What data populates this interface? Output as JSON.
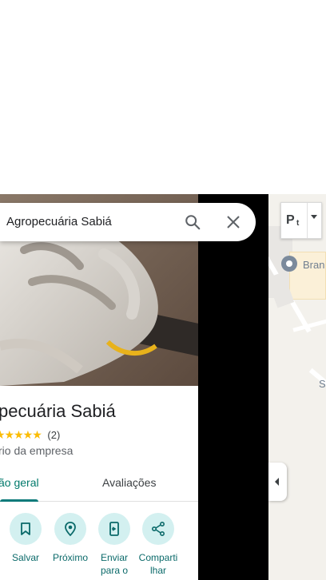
{
  "search": {
    "query": "Agropecuária Sabiá"
  },
  "place": {
    "title": "Agropecuária Sabiá",
    "title_visible": "pecuária Sabiá",
    "rating_stars": "★★★★★",
    "review_count": "(2)",
    "category": "rio da empresa"
  },
  "tabs": [
    {
      "label": "ão geral",
      "active": true
    },
    {
      "label": "Avaliações",
      "active": false
    }
  ],
  "actions": [
    {
      "label": "Salvar",
      "icon": "bookmark-icon"
    },
    {
      "label": "Próximo",
      "icon": "nearby-icon"
    },
    {
      "label": "Enviar para o",
      "icon": "send-to-phone-icon"
    },
    {
      "label": "Comparti lhar",
      "icon": "share-icon"
    }
  ],
  "map": {
    "label_1": "Bran",
    "label_2": "S",
    "layer_glyph": "P"
  },
  "colors": {
    "accent": "#0b7a7a",
    "star": "#fbbc04",
    "action_bg": "#d3f0f0"
  }
}
